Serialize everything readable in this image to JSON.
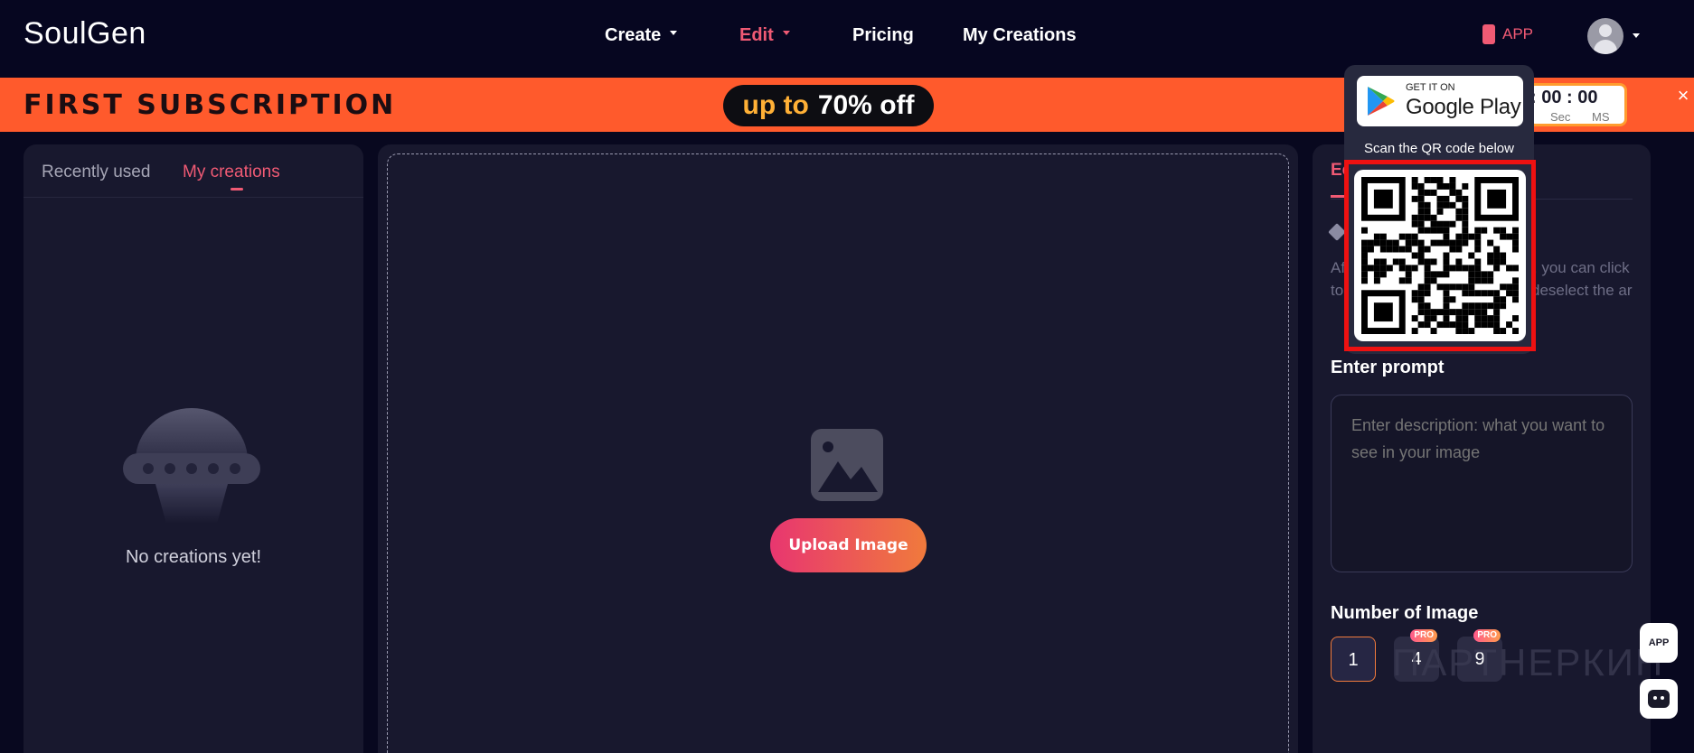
{
  "header": {
    "logo": "SoulGen",
    "nav": [
      {
        "label": "Create",
        "has_caret": true,
        "active": false
      },
      {
        "label": "Edit",
        "has_caret": true,
        "active": true
      },
      {
        "label": "Pricing",
        "has_caret": false,
        "active": false
      },
      {
        "label": "My Creations",
        "has_caret": false,
        "active": false
      }
    ],
    "app_label": "APP",
    "avatar_icon": "user-avatar-icon"
  },
  "banner": {
    "title": "FIRST SUBSCRIPTION",
    "discount_prefix": "up to",
    "discount_value": "70% off",
    "timer_digits": ": 00 : 00",
    "timer_label_sec": "Sec",
    "timer_label_ms": "MS",
    "close_label": "×"
  },
  "left_panel": {
    "tabs": [
      {
        "label": "Recently used",
        "active": false
      },
      {
        "label": "My creations",
        "active": true
      }
    ],
    "empty_text": "No creations yet!"
  },
  "center_panel": {
    "upload_button": "Upload Image",
    "icon": "image-placeholder-icon"
  },
  "right_panel": {
    "tab_label": "Ec",
    "description": "Af                                            , you can click to                                            deselect the ar",
    "prompt_label": "Enter prompt",
    "prompt_placeholder": "Enter description: what you want to see in your image",
    "num_label": "Number of Image",
    "options": [
      {
        "value": "1",
        "pro": false,
        "selected": true
      },
      {
        "value": "4",
        "pro": true,
        "selected": false
      },
      {
        "value": "9",
        "pro": true,
        "selected": false
      }
    ],
    "pro_badge": "PRO"
  },
  "app_popover": {
    "store_small": "GET IT ON",
    "store_big": "Google Play",
    "qr_caption": "Scan the QR code below",
    "highlight_color": "#ee1111"
  },
  "floating": {
    "app_label": "APP"
  },
  "watermark": "ПАРТНЕРКИН",
  "colors": {
    "accent": "#f05a74",
    "banner": "#ff5a2c",
    "background": "#08081f"
  }
}
